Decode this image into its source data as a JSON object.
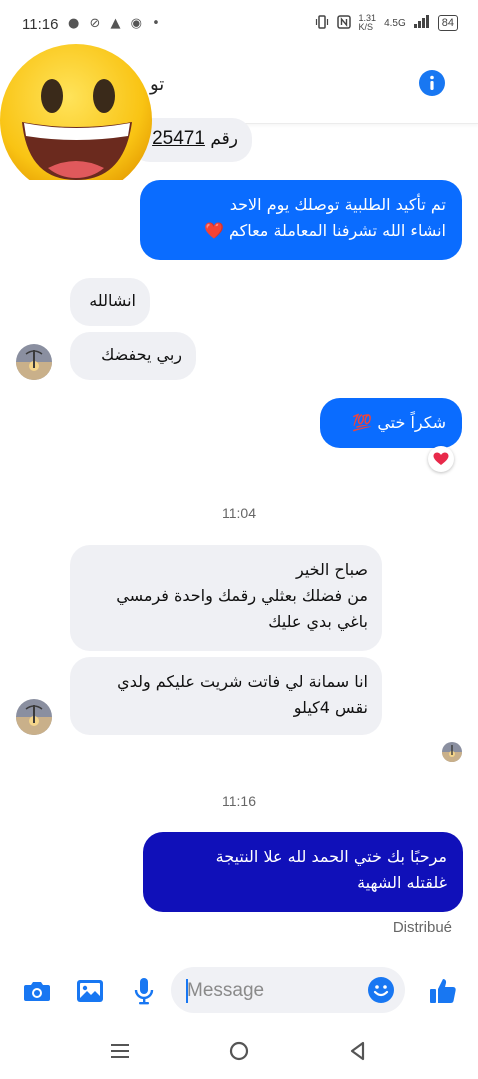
{
  "status_bar": {
    "time": "11:16",
    "notification_icons": "● ⊘ ▲ ◉ •",
    "data_speed_value": "1.31",
    "data_speed_unit": "K/S",
    "network": "4.5G",
    "battery": "84"
  },
  "header": {
    "contact_name_partial": "تو"
  },
  "messages": [
    {
      "text_prefix": "رقم",
      "text_number": "25471"
    },
    {
      "lines": [
        "تم تأكيد الطلبية توصلك يوم الاحد",
        "انشاء الله تشرفنا المعاملة معاكم ❤️"
      ]
    },
    {
      "text": "انشالله"
    },
    {
      "text": "ربي يحفضك"
    },
    {
      "text": "شكراً ختي 💯"
    },
    {
      "lines": [
        "صباح الخير",
        "من فضلك بعثلي رقمك واحدة فرمسي",
        "باغي بدي عليك"
      ]
    },
    {
      "lines": [
        "انا سمانة لي فاتت شريت عليكم ولدي",
        "نقس 4كيلو"
      ]
    },
    {
      "lines": [
        "مرحبًا بك ختي الحمد لله علا النتيجة",
        "غلقتله الشهية"
      ]
    }
  ],
  "timestamps": [
    "11:04",
    "11:16"
  ],
  "reaction": "❤️",
  "delivery_status": "Distribué",
  "composer": {
    "placeholder": "Message"
  },
  "colors": {
    "accent": "#1877f2",
    "outgoing_bubble": "#0a6cff",
    "outgoing_bubble_dark": "#1010b9",
    "incoming_bubble": "#eff0f4"
  }
}
